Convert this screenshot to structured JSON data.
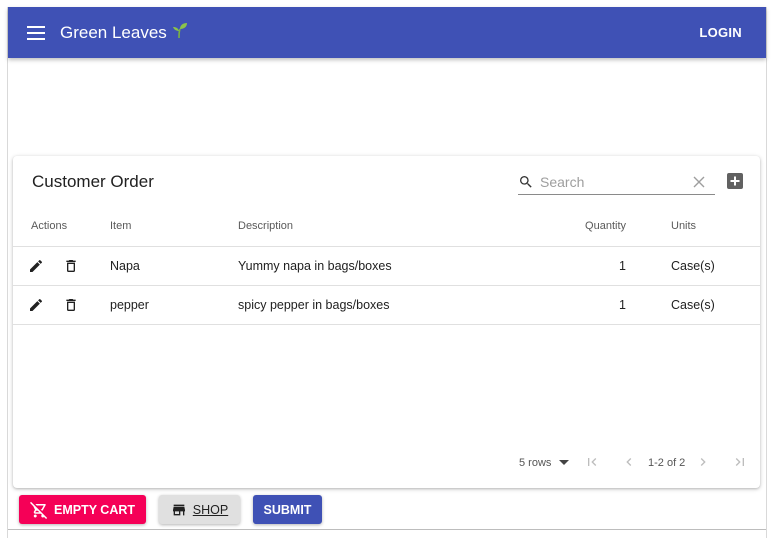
{
  "appbar": {
    "brand": "Green Leaves",
    "login_label": "LOGIN",
    "color": "#3f51b5"
  },
  "card": {
    "title": "Customer Order",
    "search_placeholder": "Search"
  },
  "table": {
    "headers": {
      "actions": "Actions",
      "item": "Item",
      "description": "Description",
      "quantity": "Quantity",
      "units": "Units"
    },
    "rows": [
      {
        "item": "Napa",
        "description": "Yummy napa in bags/boxes",
        "quantity": "1",
        "units": "Case(s)"
      },
      {
        "item": "pepper",
        "description": "spicy pepper in bags/boxes",
        "quantity": "1",
        "units": "Case(s)"
      }
    ]
  },
  "pager": {
    "rows_label": "5 rows",
    "range": "1-2 of 2"
  },
  "buttons": {
    "empty_cart": "EMPTY CART",
    "shop": "SHOP",
    "submit": "SUBMIT",
    "empty_cart_color": "#f50057"
  },
  "icons": [
    "menu-icon",
    "sprout-icon",
    "search-icon",
    "clear-icon",
    "add-box-icon",
    "edit-icon",
    "delete-icon",
    "dropdown-icon",
    "first-page-icon",
    "prev-page-icon",
    "next-page-icon",
    "last-page-icon",
    "remove-cart-icon",
    "store-icon"
  ]
}
